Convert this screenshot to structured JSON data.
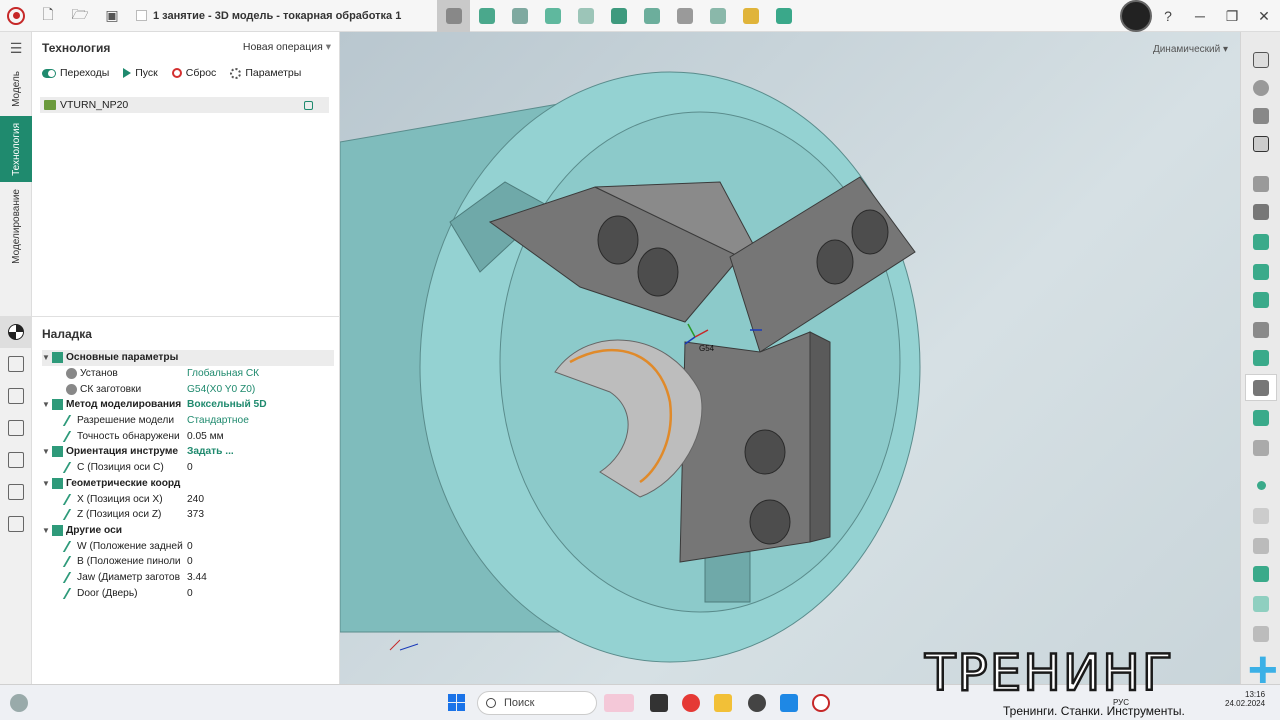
{
  "window": {
    "title": "1 занятие - 3D модель - токарная обработка 1"
  },
  "left_tabs": [
    "Модель",
    "Технология",
    "Моделирование"
  ],
  "tech_panel": {
    "title": "Технология",
    "new_operation": "Новая операция",
    "toolbar": {
      "transitions": "Переходы",
      "start": "Пуск",
      "reset": "Сброс",
      "parameters": "Параметры"
    },
    "operation": "VTURN_NP20"
  },
  "setup_panel": {
    "title": "Наладка",
    "rows": [
      {
        "type": "group",
        "name": "Основные параметры",
        "value": ""
      },
      {
        "type": "item",
        "name": "Установ",
        "value": "Глобальная СК",
        "link": true
      },
      {
        "type": "item",
        "name": "СК заготовки",
        "value": "G54(X0 Y0 Z0)",
        "link": true
      },
      {
        "type": "group",
        "name": "Метод моделирования",
        "value": "Воксельный 5D",
        "link": true
      },
      {
        "type": "item",
        "name": "Разрешение модели",
        "value": "Стандартное",
        "link": true
      },
      {
        "type": "item",
        "name": "Точность обнаружени",
        "value": "0.05 мм",
        "link": false
      },
      {
        "type": "group",
        "name": "Ориентация инструме",
        "value": "Задать ...",
        "link": true
      },
      {
        "type": "item",
        "name": "C (Позиция оси C)",
        "value": "0",
        "link": false
      },
      {
        "type": "group",
        "name": "Геометрические коорд",
        "value": ""
      },
      {
        "type": "item",
        "name": "X (Позиция оси X)",
        "value": "240",
        "link": false
      },
      {
        "type": "item",
        "name": "Z (Позиция оси Z)",
        "value": "373",
        "link": false
      },
      {
        "type": "group",
        "name": "Другие оси",
        "value": ""
      },
      {
        "type": "item",
        "name": "W (Положение задней",
        "value": "0",
        "link": false
      },
      {
        "type": "item",
        "name": "B (Положение пиноли",
        "value": "0",
        "link": false
      },
      {
        "type": "item",
        "name": "Jaw (Диаметр заготов",
        "value": "3.44",
        "link": false
      },
      {
        "type": "item",
        "name": "Door (Дверь)",
        "value": "0",
        "link": false
      }
    ]
  },
  "viewport": {
    "view_mode": "Динамический",
    "origin_label": "G54"
  },
  "taskbar": {
    "search_placeholder": "Поиск"
  },
  "watermark": {
    "big": "ТРЕНИНГ",
    "plus": "+",
    "tagline": "Тренинги. Станки. Инструменты.",
    "time": "13:16",
    "date": "24.02.2024",
    "lang": "РУС"
  },
  "colors": {
    "accent": "#1f8a6e",
    "chuck": "#8fcfcf",
    "jaws": "#6f6f6f"
  }
}
